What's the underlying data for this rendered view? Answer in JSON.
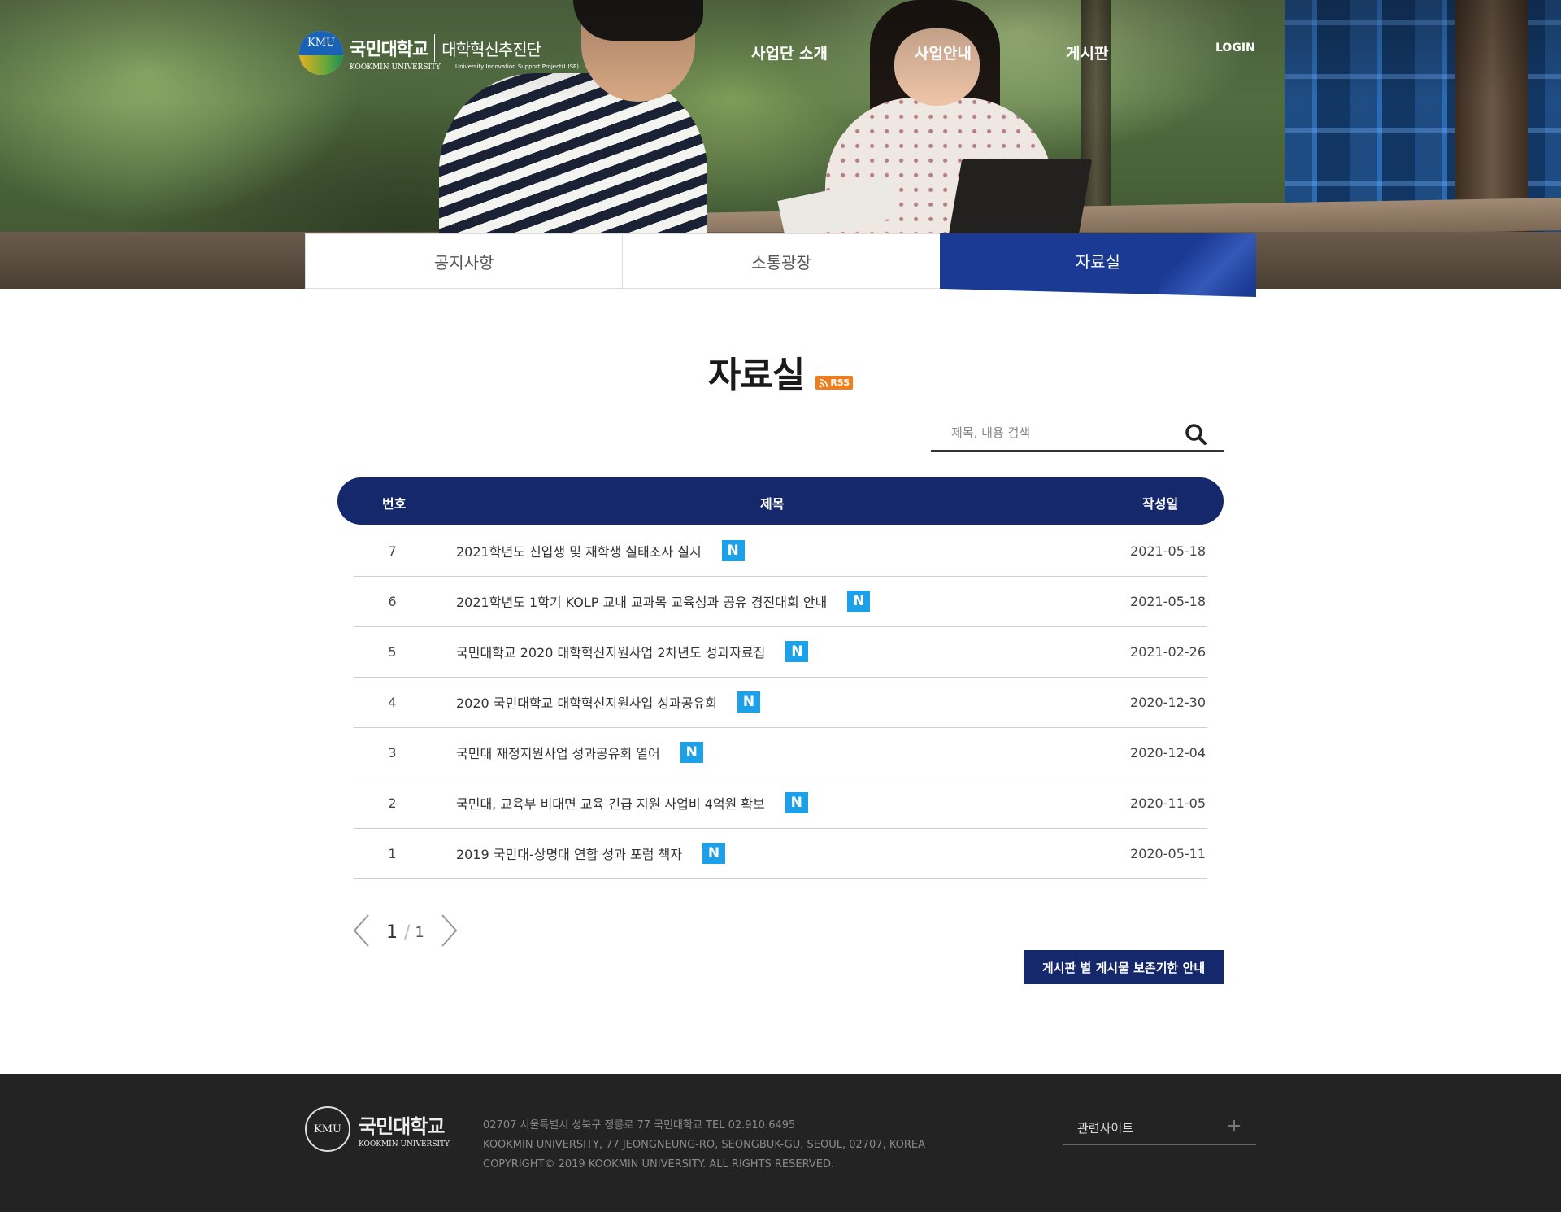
{
  "header": {
    "logo_kr": "국민대학교",
    "logo_en": "KOOKMIN UNIVERSITY",
    "logo_sub": "대학혁신추진단",
    "logo_sub_en": "University Innovation Support Project(UISP)",
    "logo_mark": "KMU",
    "nav": [
      "사업단 소개",
      "사업안내",
      "게시판"
    ],
    "login": "LOGIN"
  },
  "tabs": [
    {
      "label": "공지사항",
      "active": false
    },
    {
      "label": "소통광장",
      "active": false
    },
    {
      "label": "자료실",
      "active": true
    }
  ],
  "page": {
    "title": "자료실",
    "rss_label": "RSS"
  },
  "search": {
    "placeholder": "제목, 내용 검색",
    "value": ""
  },
  "table": {
    "columns": [
      "번호",
      "제목",
      "작성일"
    ],
    "new_badge": "N",
    "rows": [
      {
        "num": "7",
        "title": "2021학년도 신입생 및 재학생 실태조사 실시",
        "date": "2021-05-18",
        "is_new": true
      },
      {
        "num": "6",
        "title": "2021학년도 1학기 KOLP 교내 교과목 교육성과 공유 경진대회 안내",
        "date": "2021-05-18",
        "is_new": true
      },
      {
        "num": "5",
        "title": "국민대학교 2020 대학혁신지원사업 2차년도 성과자료집",
        "date": "2021-02-26",
        "is_new": true
      },
      {
        "num": "4",
        "title": "2020 국민대학교 대학혁신지원사업 성과공유회",
        "date": "2020-12-30",
        "is_new": true
      },
      {
        "num": "3",
        "title": "국민대 재정지원사업 성과공유회 열어",
        "date": "2020-12-04",
        "is_new": true
      },
      {
        "num": "2",
        "title": "국민대, 교육부 비대면 교육 긴급 지원 사업비 4억원 확보",
        "date": "2020-11-05",
        "is_new": true
      },
      {
        "num": "1",
        "title": "2019 국민대-상명대 연합 성과 포럼 책자",
        "date": "2020-05-11",
        "is_new": true
      }
    ]
  },
  "pagination": {
    "current": "1",
    "separator": "/",
    "total": "1"
  },
  "retention_button": "게시판 별 게시물 보존기한 안내",
  "footer": {
    "logo_kr": "국민대학교",
    "logo_en": "KOOKMIN UNIVERSITY",
    "logo_mark": "KMU",
    "address_kr": "02707 서울특별시 성북구 정릉로 77 국민대학교 TEL 02.910.6495",
    "address_en": "KOOKMIN UNIVERSITY, 77 JEONGNEUNG-RO, SEONGBUK-GU, SEOUL, 02707, KOREA",
    "copyright": "COPYRIGHT© 2019 KOOKMIN UNIVERSITY. ALL RIGHTS RESERVED.",
    "related_sites": "관련사이트"
  },
  "colors": {
    "primary_navy": "#15286b",
    "active_tab_blue": "#1a3a94",
    "new_badge_blue": "#1ca0e8",
    "rss_orange": "#f07c1b",
    "footer_bg": "#232323"
  }
}
